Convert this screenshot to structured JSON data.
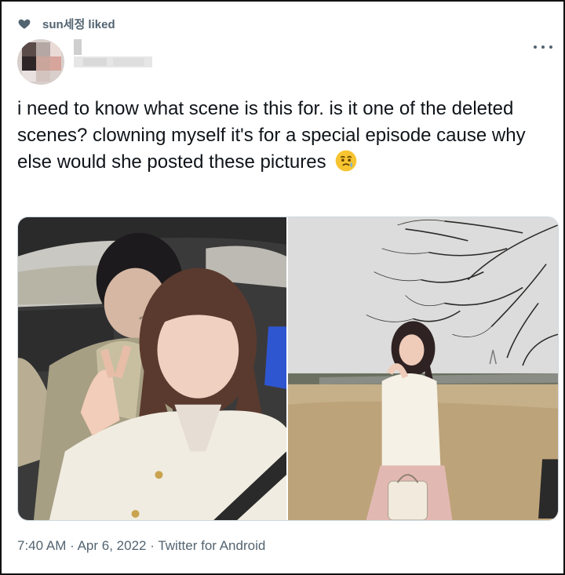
{
  "social_context": {
    "icon": "heart-icon",
    "text": "sun세정 liked"
  },
  "author": {
    "avatar": "blurred-avatar",
    "name_blurred": true
  },
  "more_icon": "more-options-icon",
  "tweet": {
    "text": "i need to know what scene is this for. is it one of the deleted scenes? clowning myself it's for a special episode cause why else would she posted these pictures",
    "emoji": "crying-face-emoji"
  },
  "media": {
    "photos": [
      {
        "id": "photo-1",
        "description_icon": "car-selfie-photo"
      },
      {
        "id": "photo-2",
        "description_icon": "park-photo"
      }
    ]
  },
  "meta": {
    "time": "7:40 AM",
    "date": "Apr 6, 2022",
    "source": "Twitter for Android",
    "separator": "·"
  },
  "colors": {
    "text_primary": "#0f1419",
    "text_secondary": "#536471",
    "border": "#cfd9de",
    "emoji_yellow": "#f7c431",
    "tear_blue": "#5fb5f0"
  }
}
